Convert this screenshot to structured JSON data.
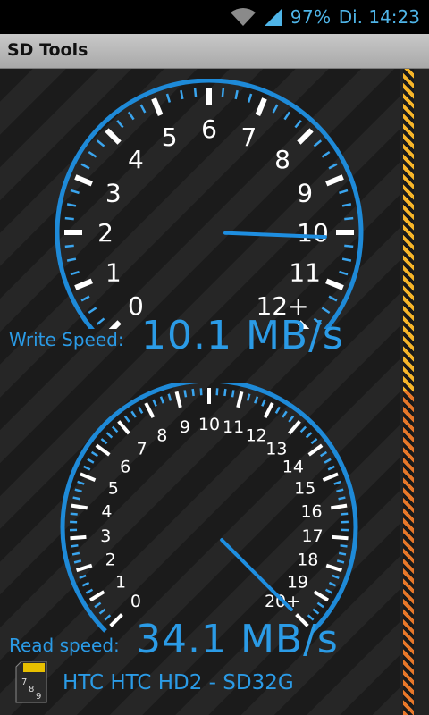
{
  "status_bar": {
    "battery": "97%",
    "time": "Di. 14:23",
    "icons": [
      "wifi-icon",
      "cell-signal-icon"
    ]
  },
  "app": {
    "title": "SD Tools"
  },
  "write_gauge": {
    "labels": [
      "0",
      "1",
      "2",
      "3",
      "4",
      "5",
      "6",
      "7",
      "8",
      "9",
      "10",
      "11",
      "12+"
    ],
    "value": 10.1,
    "max": 12
  },
  "write": {
    "label": "Write Speed:",
    "value": "10.1 MB/s"
  },
  "read_gauge": {
    "labels": [
      "0",
      "1",
      "2",
      "3",
      "4",
      "5",
      "6",
      "7",
      "8",
      "9",
      "10",
      "11",
      "12",
      "13",
      "14",
      "15",
      "16",
      "17",
      "18",
      "19",
      "20+"
    ],
    "value": 34.1,
    "max": 20
  },
  "read": {
    "label": "Read speed:",
    "value": "34.1 MB/s"
  },
  "device": {
    "name": "HTC HTC HD2 - SD32G",
    "icon": "sd-card-icon"
  },
  "colors": {
    "accent": "#2b9be6",
    "stripe_top": "#f7b62a",
    "stripe_bottom": "#e8782a"
  }
}
